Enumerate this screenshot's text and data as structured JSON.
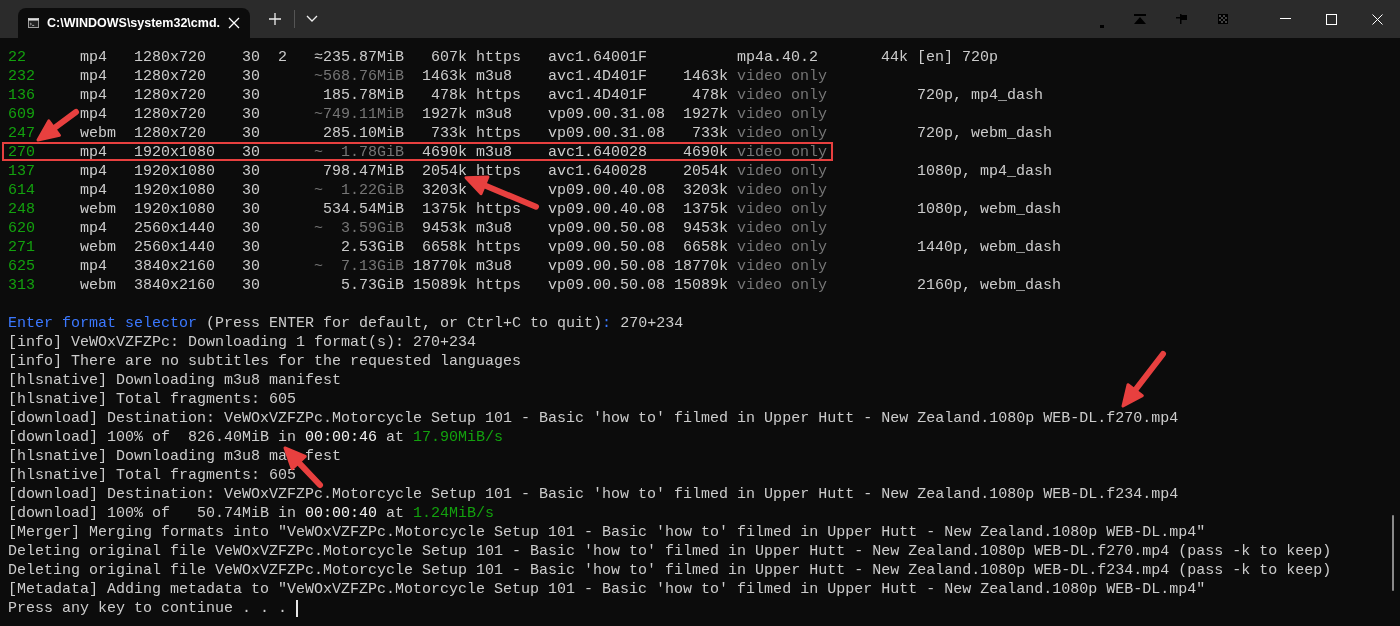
{
  "window": {
    "tab_title": "C:\\WINDOWS\\system32\\cmd."
  },
  "formats": {
    "rows": [
      {
        "id": "22",
        "ext": "mp4",
        "resolution": "1280x720",
        "fps": "30",
        "ch": "2",
        "filesize": "≈235.87MiB",
        "filesize_dim": false,
        "tbr": "607k",
        "proto": "https",
        "vcodec": "avc1.64001F",
        "acodec": "mp4a.40.2",
        "acodec_dim": false,
        "abr": "44k",
        "more_info": "[en] 720p",
        "highlighted": false
      },
      {
        "id": "232",
        "ext": "mp4",
        "resolution": "1280x720",
        "fps": "30",
        "filesize": "~568.76MiB",
        "filesize_dim": true,
        "tbr": "1463k",
        "proto": "m3u8",
        "vcodec": "avc1.4D401F",
        "vbr": "1463k",
        "acodec": "video only",
        "acodec_dim": true,
        "highlighted": false
      },
      {
        "id": "136",
        "ext": "mp4",
        "resolution": "1280x720",
        "fps": "30",
        "filesize": "185.78MiB",
        "filesize_dim": false,
        "tbr": "478k",
        "proto": "https",
        "vcodec": "avc1.4D401F",
        "vbr": "478k",
        "acodec": "video only",
        "acodec_dim": true,
        "more_info": "720p, mp4_dash",
        "highlighted": false
      },
      {
        "id": "609",
        "ext": "mp4",
        "resolution": "1280x720",
        "fps": "30",
        "filesize": "~749.11MiB",
        "filesize_dim": true,
        "tbr": "1927k",
        "proto": "m3u8",
        "vcodec": "vp09.00.31.08",
        "vbr": "1927k",
        "acodec": "video only",
        "acodec_dim": true,
        "highlighted": false
      },
      {
        "id": "247",
        "ext": "webm",
        "resolution": "1280x720",
        "fps": "30",
        "filesize": "285.10MiB",
        "filesize_dim": false,
        "tbr": "733k",
        "proto": "https",
        "vcodec": "vp09.00.31.08",
        "vbr": "733k",
        "acodec": "video only",
        "acodec_dim": true,
        "more_info": "720p, webm_dash",
        "highlighted": false
      },
      {
        "id": "270",
        "ext": "mp4",
        "resolution": "1920x1080",
        "fps": "30",
        "filesize": "~  1.78GiB",
        "filesize_dim": true,
        "tbr": "4690k",
        "proto": "m3u8",
        "vcodec": "avc1.640028",
        "vbr": "4690k",
        "acodec": "video only",
        "acodec_dim": true,
        "highlighted": true
      },
      {
        "id": "137",
        "ext": "mp4",
        "resolution": "1920x1080",
        "fps": "30",
        "filesize": "798.47MiB",
        "filesize_dim": false,
        "tbr": "2054k",
        "proto": "https",
        "vcodec": "avc1.640028",
        "vbr": "2054k",
        "acodec": "video only",
        "acodec_dim": true,
        "more_info": "1080p, mp4_dash",
        "highlighted": false
      },
      {
        "id": "614",
        "ext": "mp4",
        "resolution": "1920x1080",
        "fps": "30",
        "filesize": "~  1.22GiB",
        "filesize_dim": true,
        "tbr": "3203k",
        "vcodec": "vp09.00.40.08",
        "vbr": "3203k",
        "acodec": "video only",
        "acodec_dim": true,
        "highlighted": false
      },
      {
        "id": "248",
        "ext": "webm",
        "resolution": "1920x1080",
        "fps": "30",
        "filesize": "534.54MiB",
        "filesize_dim": false,
        "tbr": "1375k",
        "proto": "https",
        "vcodec": "vp09.00.40.08",
        "vbr": "1375k",
        "acodec": "video only",
        "acodec_dim": true,
        "more_info": "1080p, webm_dash",
        "highlighted": false
      },
      {
        "id": "620",
        "ext": "mp4",
        "resolution": "2560x1440",
        "fps": "30",
        "filesize": "~  3.59GiB",
        "filesize_dim": true,
        "tbr": "9453k",
        "proto": "m3u8",
        "vcodec": "vp09.00.50.08",
        "vbr": "9453k",
        "acodec": "video only",
        "acodec_dim": true,
        "highlighted": false
      },
      {
        "id": "271",
        "ext": "webm",
        "resolution": "2560x1440",
        "fps": "30",
        "filesize": "2.53GiB",
        "filesize_dim": false,
        "tbr": "6658k",
        "proto": "https",
        "vcodec": "vp09.00.50.08",
        "vbr": "6658k",
        "acodec": "video only",
        "acodec_dim": true,
        "more_info": "1440p, webm_dash",
        "highlighted": false
      },
      {
        "id": "625",
        "ext": "mp4",
        "resolution": "3840x2160",
        "fps": "30",
        "filesize": "~  7.13GiB",
        "filesize_dim": true,
        "tbr": "18770k",
        "proto": "m3u8",
        "vcodec": "vp09.00.50.08",
        "vbr": "18770k",
        "acodec": "video only",
        "acodec_dim": true,
        "highlighted": false
      },
      {
        "id": "313",
        "ext": "webm",
        "resolution": "3840x2160",
        "fps": "30",
        "filesize": "5.73GiB",
        "filesize_dim": false,
        "tbr": "15089k",
        "proto": "https",
        "vcodec": "vp09.00.50.08",
        "vbr": "15089k",
        "acodec": "video only",
        "acodec_dim": true,
        "more_info": "2160p, webm_dash",
        "highlighted": false
      }
    ]
  },
  "log": {
    "cursor_visible": true,
    "lines": [
      {
        "segments": [
          {
            "text": "Enter format selector",
            "kind": "accent"
          },
          {
            "text": " (Press ENTER for default, or Ctrl+C to quit)",
            "kind": "plain"
          },
          {
            "text": ":",
            "kind": "accent"
          },
          {
            "text": " 270+234",
            "kind": "plain"
          }
        ]
      },
      {
        "segments": [
          {
            "text": "[info] VeWOxVZFZPc: Downloading 1 format(s): 270+234",
            "kind": "plain"
          }
        ]
      },
      {
        "segments": [
          {
            "text": "[info] There are no subtitles for the requested languages",
            "kind": "plain"
          }
        ]
      },
      {
        "segments": [
          {
            "text": "[hlsnative] Downloading m3u8 manifest",
            "kind": "plain"
          }
        ]
      },
      {
        "segments": [
          {
            "text": "[hlsnative] Total fragments: 605",
            "kind": "plain"
          }
        ]
      },
      {
        "segments": [
          {
            "text": "[download] Destination: VeWOxVZFZPc.Motorcycle Setup 101 - Basic 'how to' filmed in Upper Hutt - New Zealand.1080p WEB-DL.f270.mp4",
            "kind": "plain"
          }
        ]
      },
      {
        "segments": [
          {
            "text": "[download] 100% of  826.40MiB in ",
            "kind": "plain"
          },
          {
            "text": "00:00:46",
            "kind": "bright"
          },
          {
            "text": " at ",
            "kind": "plain"
          },
          {
            "text": "17.90MiB/s",
            "kind": "success"
          }
        ]
      },
      {
        "segments": [
          {
            "text": "[hlsnative] Downloading m3u8 ma",
            "kind": "plain"
          }
        ],
        "tail": {
          "text": "fest",
          "covered_before": true
        }
      },
      {
        "segments": [
          {
            "text": "[hlsnative] Total fragments: 605",
            "kind": "plain"
          }
        ]
      },
      {
        "segments": [
          {
            "text": "[download] Destination: VeWOxVZFZPc.Motorcycle Setup 101 - Basic 'how to' filmed in Upper Hutt - New Zealand.1080p WEB-DL.f234.mp4",
            "kind": "plain"
          }
        ]
      },
      {
        "segments": [
          {
            "text": "[download] 100% of   50.74MiB in ",
            "kind": "plain"
          },
          {
            "text": "00:00:40",
            "kind": "bright"
          },
          {
            "text": " at ",
            "kind": "plain"
          },
          {
            "text": "1.24MiB/s",
            "kind": "success"
          }
        ]
      },
      {
        "segments": [
          {
            "text": "[Merger] Merging formats into \"VeWOxVZFZPc.Motorcycle Setup 101 - Basic 'how to' filmed in Upper Hutt - New Zealand.1080p WEB-DL.mp4\"",
            "kind": "plain"
          }
        ]
      },
      {
        "segments": [
          {
            "text": "Deleting original file VeWOxVZFZPc.Motorcycle Setup 101 - Basic 'how to' filmed in Upper Hutt - New Zealand.1080p WEB-DL.f270.mp4 (pass -k to keep)",
            "kind": "plain"
          }
        ]
      },
      {
        "segments": [
          {
            "text": "Deleting original file VeWOxVZFZPc.Motorcycle Setup 101 - Basic 'how to' filmed in Upper Hutt - New Zealand.1080p WEB-DL.f234.mp4 (pass -k to keep)",
            "kind": "plain"
          }
        ]
      },
      {
        "segments": [
          {
            "text": "[Metadata] Adding metadata to \"VeWOxVZFZPc.Motorcycle Setup 101 - Basic 'how to' filmed in Upper Hutt - New Zealand.1080p WEB-DL.mp4\"",
            "kind": "plain"
          }
        ]
      },
      {
        "segments": [
          {
            "text": "Press any key to continue . . . ",
            "kind": "plain"
          }
        ]
      }
    ]
  }
}
